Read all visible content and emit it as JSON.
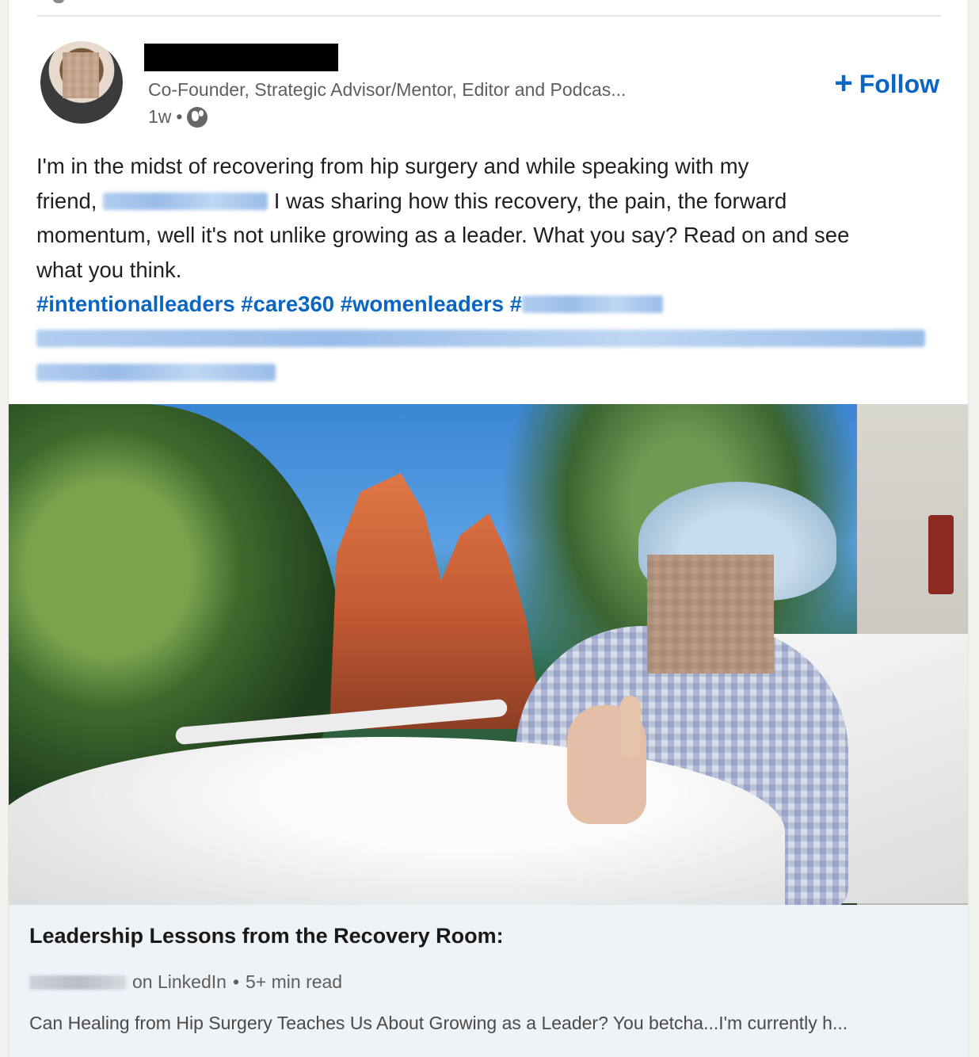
{
  "post": {
    "author_headline": "Co-Founder, Strategic Advisor/Mentor, Editor and Podcas...",
    "time": "1w",
    "separator": "•",
    "follow_label": "Follow",
    "follow_icon": "plus-icon",
    "visibility_icon": "globe-icon",
    "body": {
      "line1": "I'm in the midst of recovering from hip surgery and while speaking with my",
      "line2_prefix": "friend, ",
      "line2_suffix": " I was sharing how this recovery, the pain, the forward",
      "line3": "momentum, well it's not unlike growing as a leader. What you say? Read on and see",
      "line4": "what you think."
    },
    "hashtags": {
      "tag1": "#intentionalleaders",
      "tag2": "#care360",
      "tag3": "#womenleaders",
      "tag4_prefix": "#"
    }
  },
  "article_preview": {
    "title": "Leadership Lessons from the Recovery Room:",
    "source_suffix": "on LinkedIn",
    "read_time": "5+ min read",
    "separator": "•",
    "description": "Can Healing from Hip Surgery Teaches Us About Growing as a Leader? You betcha...I'm currently h..."
  }
}
